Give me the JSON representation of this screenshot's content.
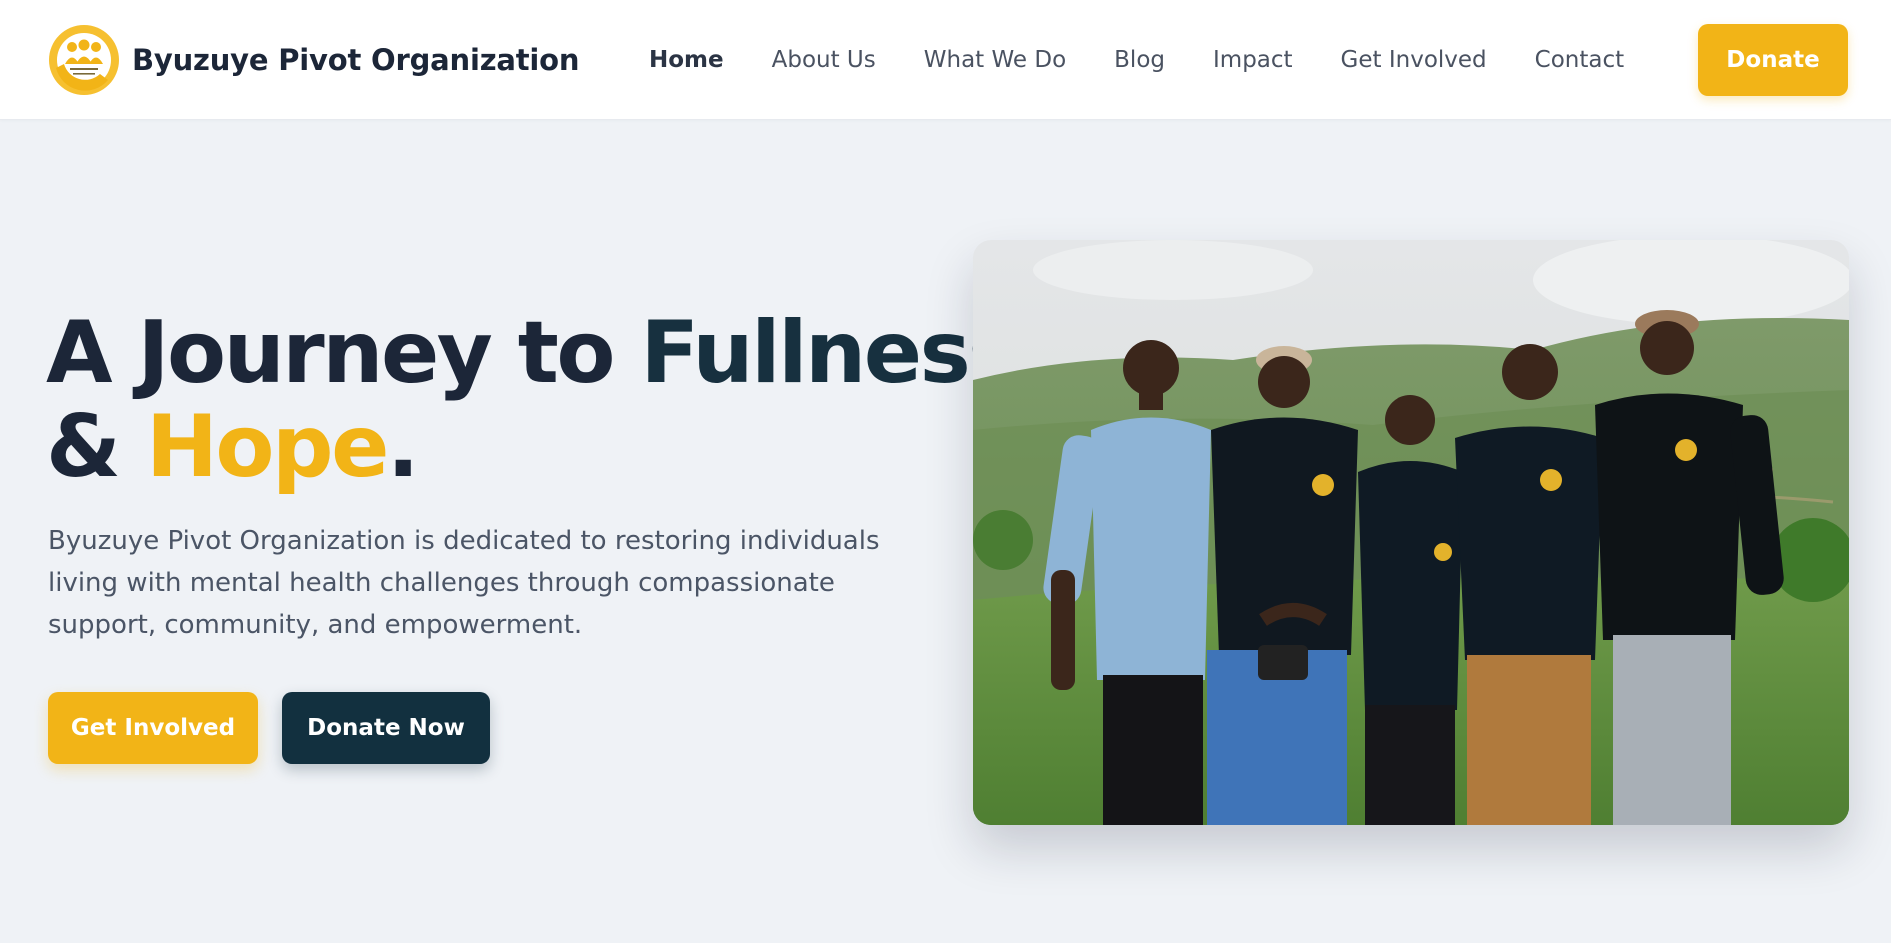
{
  "header": {
    "brand_name": "Byuzuye Pivot Organization",
    "logo_text_line1": "Byuzuye Pivot",
    "logo_text_line2": "Organization",
    "nav": [
      {
        "label": "Home",
        "active": true
      },
      {
        "label": "About Us",
        "active": false
      },
      {
        "label": "What We Do",
        "active": false
      },
      {
        "label": "Blog",
        "active": false
      },
      {
        "label": "Impact",
        "active": false
      },
      {
        "label": "Get Involved",
        "active": false
      },
      {
        "label": "Contact",
        "active": false
      }
    ],
    "donate_label": "Donate"
  },
  "hero": {
    "title_part1": "A Journey to ",
    "title_part2": "Fullness",
    "title_part3": "& ",
    "title_highlight": "Hope",
    "title_period": ".",
    "description": "Byuzuye Pivot Organization is dedicated to restoring individuals living with mental health challenges through compassionate support, community, and empowerment.",
    "primary_button": "Get Involved",
    "secondary_button": "Donate Now",
    "photo_icon": "group-photo-image"
  },
  "colors": {
    "accent": "#f2b417",
    "dark": "#12303f",
    "text": "#1c2638",
    "background": "#eff2f6"
  }
}
